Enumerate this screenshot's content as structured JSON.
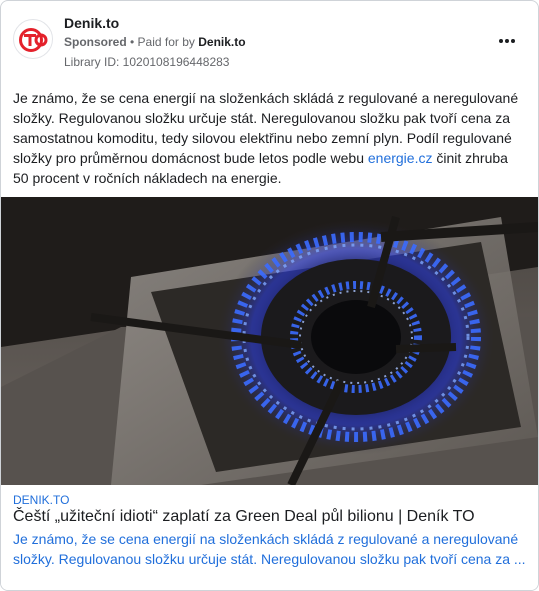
{
  "post": {
    "page_name": "Denik.to",
    "sponsored_label": "Sponsored",
    "separator": " • ",
    "paid_for_prefix": "Paid for by ",
    "paid_for_name": "Denik.to",
    "library_id": "Library ID: 1020108196448283",
    "more_icon": "more-horizontal-icon"
  },
  "body": {
    "text_before_link": "Je známo, že se cena energií na složenkách skládá z regulované a neregulované složky. Regulovanou složku určuje stát. Neregulovanou složku pak tvoří cena za samostatnou komoditu, tedy silovou elektřinu nebo zemní plyn. Podíl regulované složky pro průměrnou domácnost bude letos podle webu ",
    "link_text": "energie.cz",
    "text_after_link": " činit zhruba 50 procent v ročních nákladech na energie."
  },
  "link_preview": {
    "domain": "DENIK.TO",
    "title": "Čeští „užiteční idioti“ zaplatí za Green Deal půl bilionu | Deník TO",
    "description": "Je známo, že se cena energií na složenkách skládá z regulované a neregulované složky. Regulovanou složku určuje stát. Neregulovanou složku pak tvoří cena za ..."
  },
  "colors": {
    "brand_red": "#e4212b",
    "link_blue": "#216fdb",
    "flame_blue": "#3b6cff"
  }
}
